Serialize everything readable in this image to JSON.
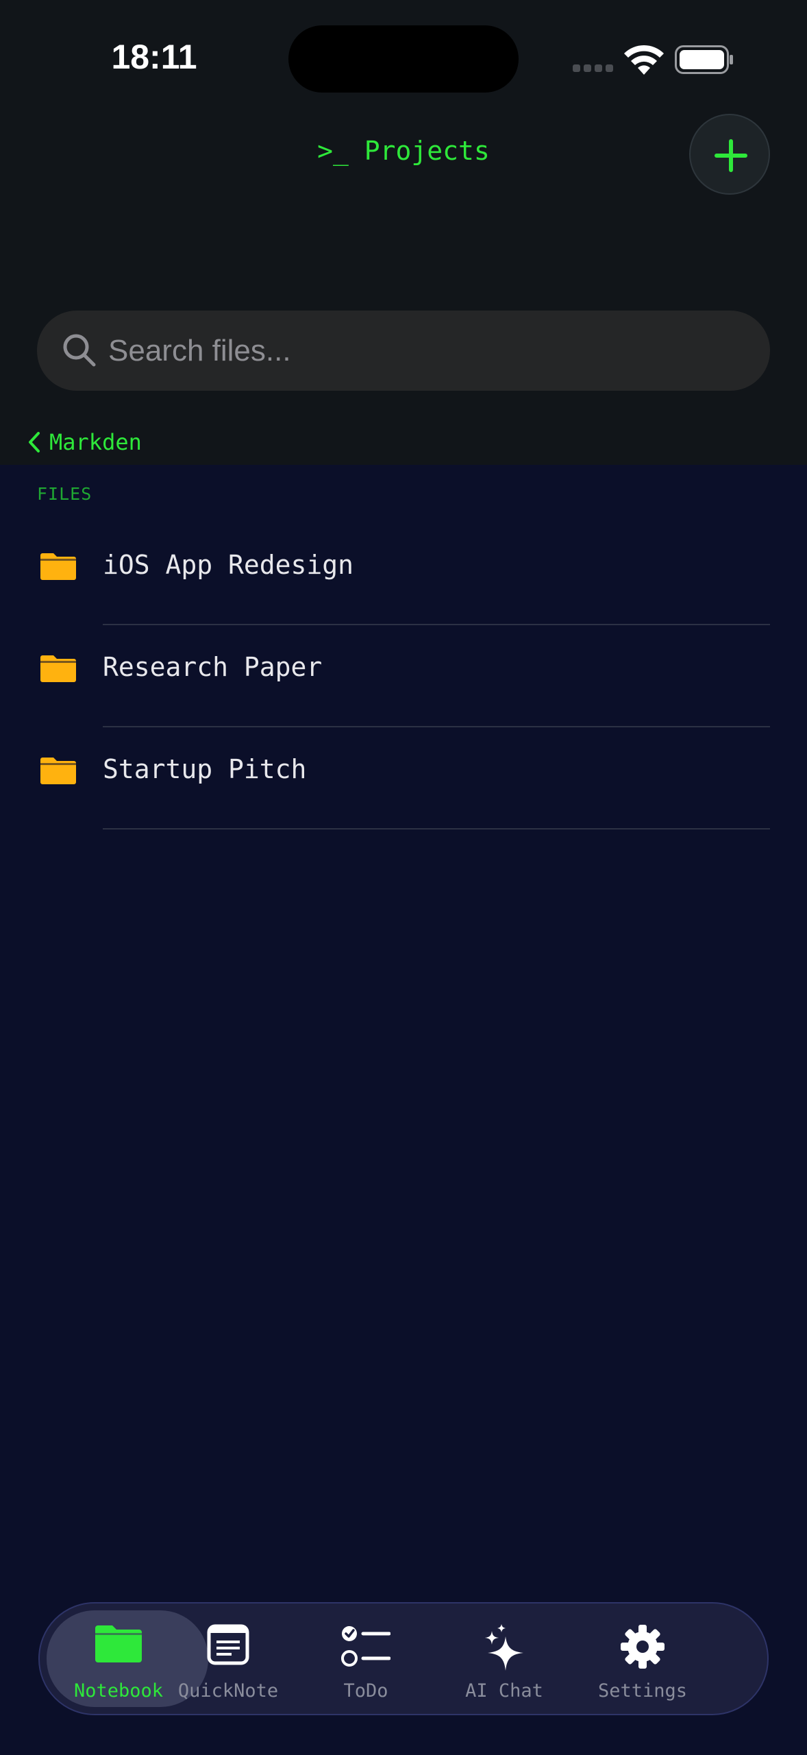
{
  "status_bar": {
    "time": "18:11"
  },
  "header": {
    "title": ">_ Projects",
    "add_button_icon": "plus-icon"
  },
  "search": {
    "placeholder": "Search files..."
  },
  "breadcrumb": {
    "back_label": "Markden"
  },
  "files": {
    "section_title": "FILES",
    "items": [
      {
        "name": "iOS App Redesign",
        "icon": "folder-icon"
      },
      {
        "name": "Research Paper",
        "icon": "folder-icon"
      },
      {
        "name": "Startup Pitch",
        "icon": "folder-icon"
      }
    ]
  },
  "tabbar": {
    "active": "Notebook",
    "tabs": [
      {
        "label": "Notebook",
        "icon": "folder-icon"
      },
      {
        "label": "QuickNote",
        "icon": "note-icon"
      },
      {
        "label": "ToDo",
        "icon": "checklist-icon"
      },
      {
        "label": "AI Chat",
        "icon": "sparkles-icon"
      },
      {
        "label": "Settings",
        "icon": "gear-icon"
      }
    ]
  },
  "colors": {
    "accent": "#2ee83a",
    "folder": "#ffb20f",
    "background": "#0b0f29",
    "header_bg": "#111519"
  }
}
